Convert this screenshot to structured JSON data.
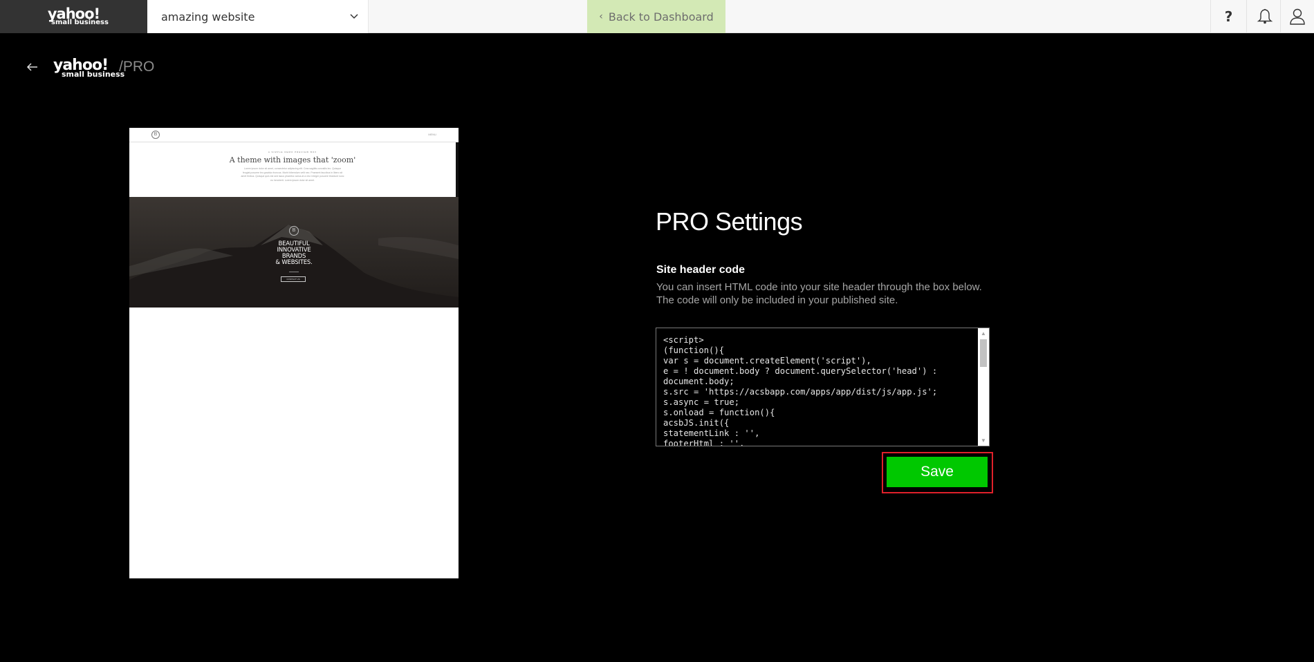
{
  "topbar": {
    "logo": {
      "wordmark": "yahoo!",
      "subtitle": "small business"
    },
    "site_selector": {
      "selected": "amazing website",
      "icon": "chevron-down-icon"
    },
    "back_to_dashboard": {
      "label": "Back to Dashboard",
      "icon": "chevron-left-icon"
    },
    "icons": {
      "help": {
        "name": "help-icon",
        "glyph": "?"
      },
      "notifications": {
        "name": "bell-icon"
      },
      "account": {
        "name": "user-icon"
      }
    }
  },
  "subheader": {
    "back_icon": "arrow-left-icon",
    "logo": {
      "wordmark": "yahoo!",
      "subtitle": "small business"
    },
    "product_tag": "/PRO"
  },
  "preview": {
    "nav_badge": "B",
    "nav_menu": "MENU",
    "kicker": "A SIMPLE DEMO PREVIEW BOX",
    "title": "A theme with images that 'zoom'",
    "body": "Lorem ipsum dolor sit amet, consectetur adipiscing elit. Cras sagittis convallis leo. Quisque feugiat posuere leo gravida rhoncus. Morbi bibendum velit nec. Praesent faucibus in libero sit amet finibus. Quisque quis est sed lacus pharetra varius at a nisl. Integer posuere tincidunt nunc eu hendrerit. Lorem ipsum dolor sit amet.",
    "hero_emblem": "B",
    "hero_headline": [
      "BEAUTIFUL",
      "INNOVATIVE",
      "BRANDS",
      "& WEBSITES."
    ],
    "hero_cta": "CONTACT US"
  },
  "settings": {
    "title": "PRO Settings",
    "section_label": "Site header code",
    "section_description": "You can insert HTML code into your site header through the box below. The code will only be included in your published site.",
    "code_value": "<script>\n(function(){\nvar s = document.createElement('script'),\ne = ! document.body ? document.querySelector('head') :\ndocument.body;\ns.src = 'https://acsbapp.com/apps/app/dist/js/app.js';\ns.async = true;\ns.onload = function(){\nacsbJS.init({\nstatementLink : '',\nfooterHtml : '',",
    "save_label": "Save"
  },
  "colors": {
    "save_button": "#00c800",
    "highlight_border": "#e0202a",
    "back_dashboard_bg": "#d3e9b5",
    "brand_bg": "#333333"
  }
}
